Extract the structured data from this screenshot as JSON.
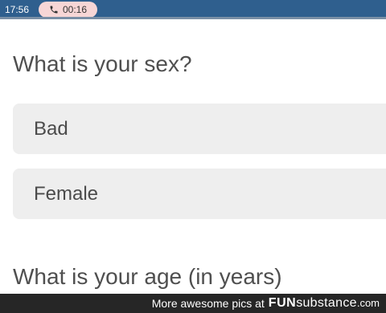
{
  "status_bar": {
    "time": "17:56",
    "call_timer": "00:16",
    "call_icon": "phone-icon"
  },
  "survey": {
    "question1": "What is your sex?",
    "options": [
      "Bad",
      "Female"
    ],
    "question2": "What is your age (in years)"
  },
  "watermark": {
    "prefix": "More awesome pics at",
    "brand_fun": "FUN",
    "brand_substance": "substance",
    "brand_com": ".com"
  },
  "colors": {
    "status_bar": "#2f5f8e",
    "call_pill": "#f7d6d6",
    "option_background": "#eeeeee",
    "footer": "#262626"
  }
}
